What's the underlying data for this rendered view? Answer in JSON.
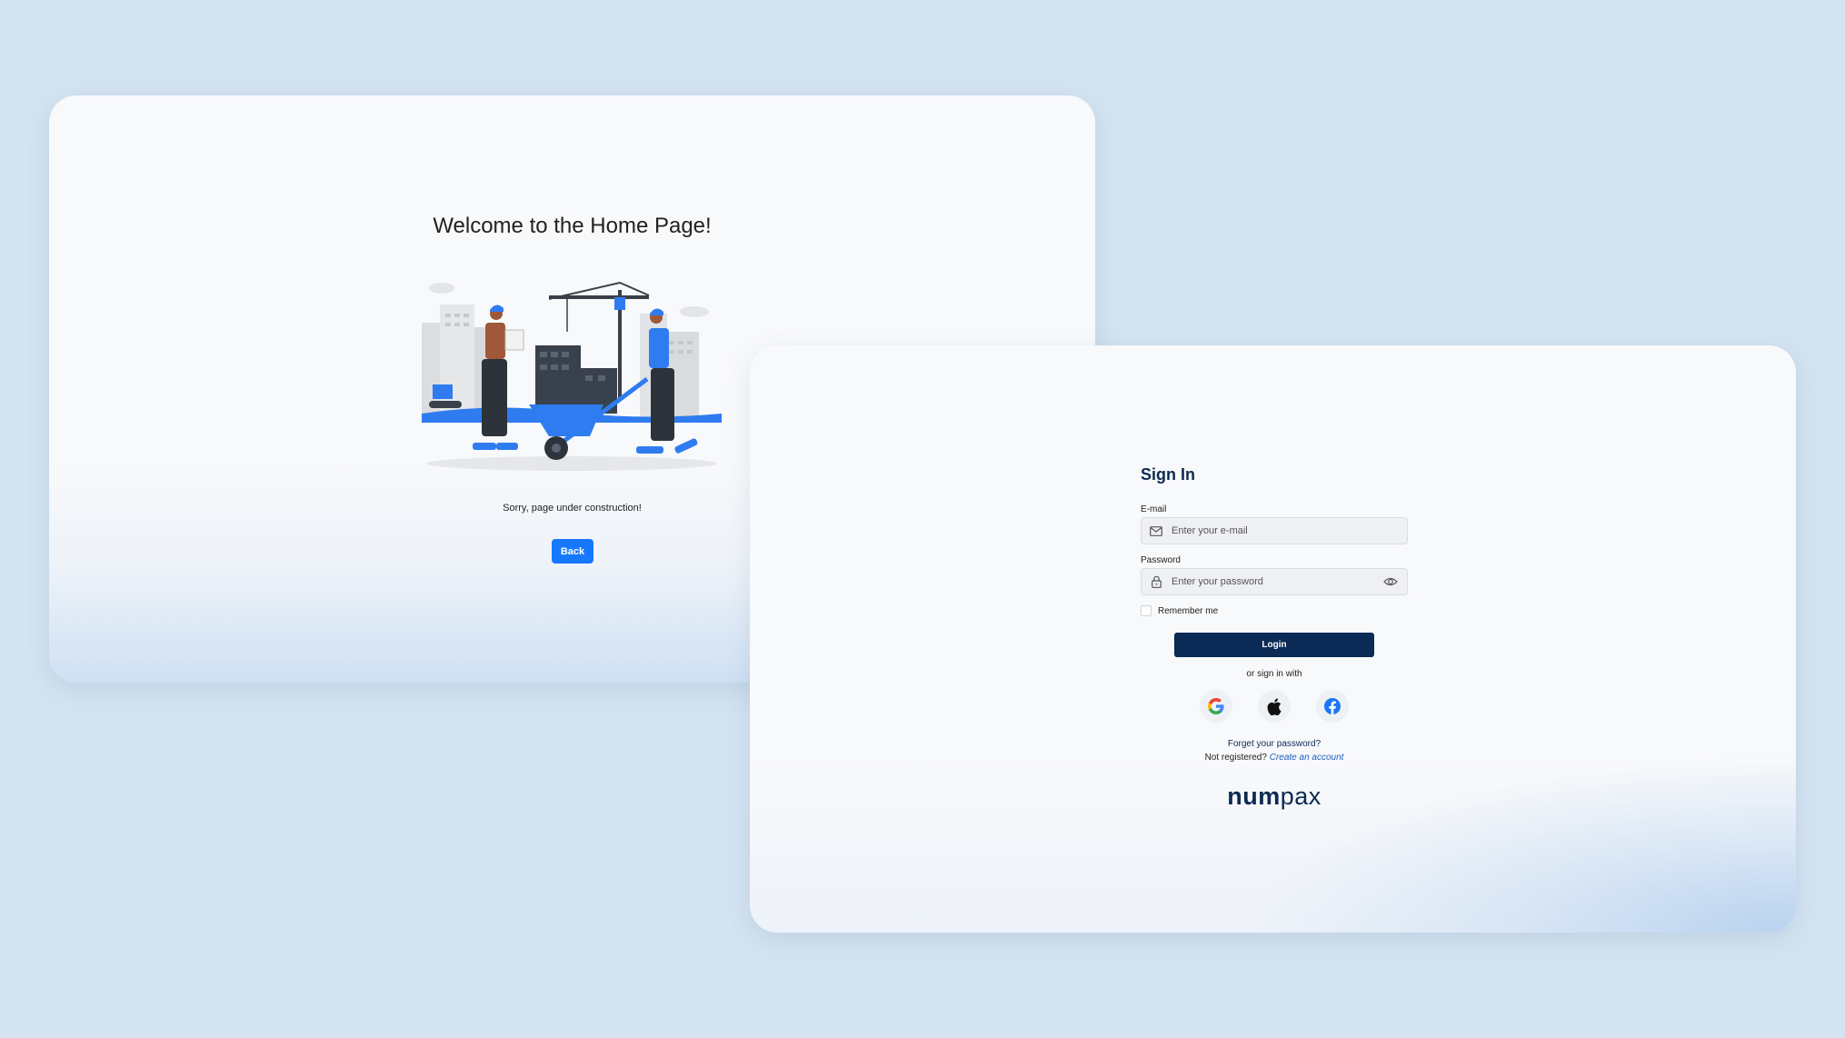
{
  "home": {
    "title": "Welcome to the Home Page!",
    "message": "Sorry, page under construction!",
    "back_label": "Back",
    "illustration_icon": "construction-workers-illustration"
  },
  "signin": {
    "title": "Sign In",
    "email_label": "E-mail",
    "email_placeholder": "Enter your e-mail",
    "email_value": "",
    "password_label": "Password",
    "password_placeholder": "Enter your password",
    "password_value": "",
    "remember_label": "Remember me",
    "remember_checked": false,
    "login_label": "Login",
    "or_text": "or sign in with",
    "social": [
      "google-icon",
      "apple-icon",
      "facebook-icon"
    ],
    "forgot_text": "Forget your password?",
    "not_registered_text": "Not registered?",
    "create_account_text": "Create an account",
    "brand_bold": "num",
    "brand_light": "pax"
  },
  "colors": {
    "background": "#d3e3f1",
    "panel": "#f8f9fb",
    "primary_blue": "#1677ff",
    "navy": "#0b2a55"
  }
}
